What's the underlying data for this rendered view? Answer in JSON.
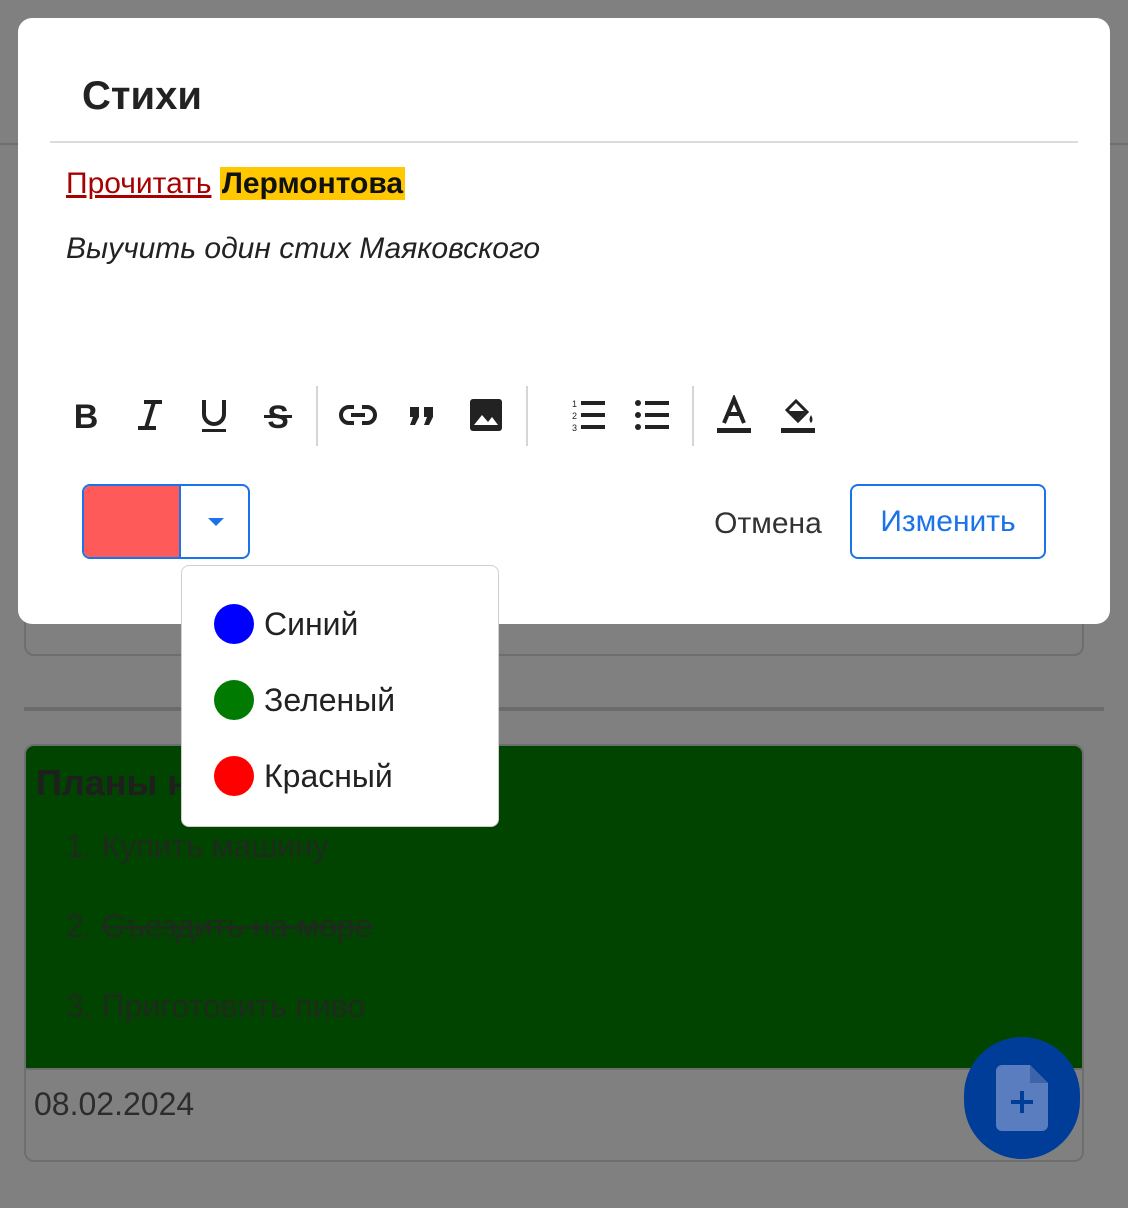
{
  "background": {
    "card_title": "Планы на",
    "card_items": [
      {
        "num": "1.",
        "text": "Купить машину",
        "strike": false
      },
      {
        "num": "2.",
        "text": "Съездить на море",
        "strike": true
      },
      {
        "num": "3.",
        "text": "Приготовить пиво",
        "strike": false
      }
    ],
    "card_date": "08.02.2024",
    "card_color": "#004400",
    "fab_icon": "file-add-icon"
  },
  "modal": {
    "title": "Стихи",
    "editor": {
      "line1_link": "Прочитать",
      "line1_highlight": "Лермонтова",
      "line2_italic": "Выучить один стих Маяковского"
    },
    "toolbar": [
      {
        "name": "bold-icon"
      },
      {
        "name": "italic-icon"
      },
      {
        "name": "underline-icon"
      },
      {
        "name": "strikethrough-icon"
      },
      {
        "name": "link-icon"
      },
      {
        "name": "quote-icon"
      },
      {
        "name": "image-icon"
      },
      {
        "name": "ordered-list-icon"
      },
      {
        "name": "bullet-list-icon"
      },
      {
        "name": "text-color-icon"
      },
      {
        "name": "fill-color-icon"
      }
    ],
    "color_picker": {
      "selected_color": "#ff5a5a",
      "accent": "#1a73e8"
    },
    "cancel_label": "Отмена",
    "submit_label": "Изменить"
  },
  "dropdown": {
    "options": [
      {
        "label": "Синий",
        "color": "#0000ff"
      },
      {
        "label": "Зеленый",
        "color": "#007a00"
      },
      {
        "label": "Красный",
        "color": "#ff0000"
      }
    ]
  }
}
